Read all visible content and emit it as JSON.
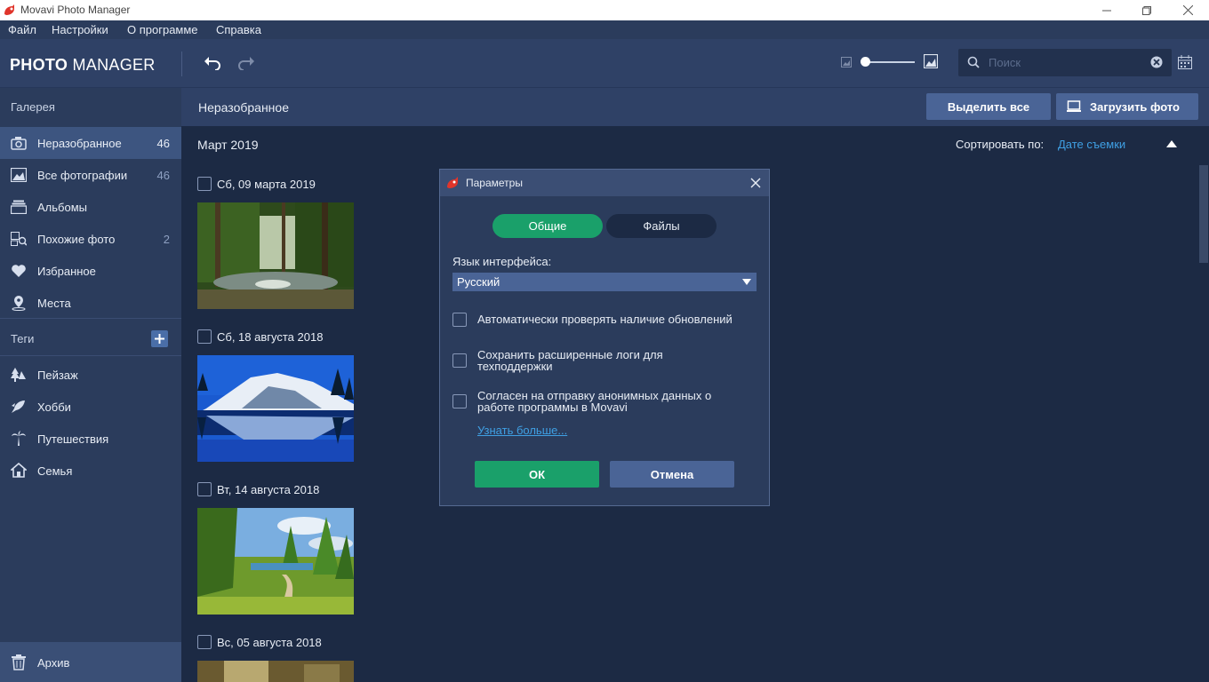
{
  "window": {
    "title": "Movavi Photo Manager",
    "controls": [
      "minimize-icon",
      "maximize-icon",
      "close-icon"
    ]
  },
  "menu": [
    "Файл",
    "Настройки",
    "О программе",
    "Справка"
  ],
  "toolbar": {
    "logo_bold": "PHOTO",
    "logo_light": " MANAGER",
    "search_placeholder": "Поиск"
  },
  "sidebar": {
    "gallery_header": "Галерея",
    "gallery": [
      {
        "label": "Неразобранное",
        "count": "46",
        "icon": "unsorted-camera-icon",
        "active": true
      },
      {
        "label": "Все фотографии",
        "count": "46",
        "icon": "photos-icon"
      },
      {
        "label": "Альбомы",
        "count": "",
        "icon": "albums-icon"
      },
      {
        "label": "Похожие фото",
        "count": "2",
        "icon": "similar-photos-icon"
      },
      {
        "label": "Избранное",
        "count": "",
        "icon": "heart-icon"
      },
      {
        "label": "Места",
        "count": "",
        "icon": "location-pin-icon"
      }
    ],
    "tags_header": "Теги",
    "tags": [
      {
        "label": "Пейзаж",
        "icon": "landscape-icon"
      },
      {
        "label": "Хобби",
        "icon": "hobby-icon"
      },
      {
        "label": "Путешествия",
        "icon": "palm-tree-icon"
      },
      {
        "label": "Семья",
        "icon": "home-icon"
      }
    ],
    "archive": {
      "label": "Архив",
      "icon": "trash-icon"
    }
  },
  "main": {
    "title": "Неразобранное",
    "select_all": "Выделить все",
    "upload": "Загрузить фото",
    "month": "Март 2019",
    "sort_label": "Сортировать по:",
    "sort_value": "Дате съемки",
    "groups": [
      {
        "date": "Сб, 09 марта 2019",
        "photo": "forest-river"
      },
      {
        "date": "Сб, 18 августа 2018",
        "photo": "snowy-mountain-lake"
      },
      {
        "date": "Вт, 14 августа 2018",
        "photo": "green-park-path"
      },
      {
        "date": "Вс, 05 августа 2018",
        "photo": "partial"
      }
    ]
  },
  "dialog": {
    "title": "Параметры",
    "tabs": [
      "Общие",
      "Файлы"
    ],
    "active_tab": "Общие",
    "language_label": "Язык интерфейса:",
    "language_value": "Русский",
    "options": [
      {
        "label": "Автоматически проверять наличие обновлений",
        "checked": false
      },
      {
        "label": "Сохранить расширенные логи для техподдержки",
        "checked": false
      },
      {
        "label": "Согласен на отправку анонимных данных о работе программы в Movavi",
        "checked": false
      }
    ],
    "learn_more": "Узнать больше...",
    "ok": "ОК",
    "cancel": "Отмена"
  },
  "colors": {
    "accent_green": "#1aa06a",
    "accent_blue": "#4a6496",
    "link": "#3fa0e4",
    "bg_dark": "#1c2a44",
    "panel": "#2b3c5c"
  }
}
